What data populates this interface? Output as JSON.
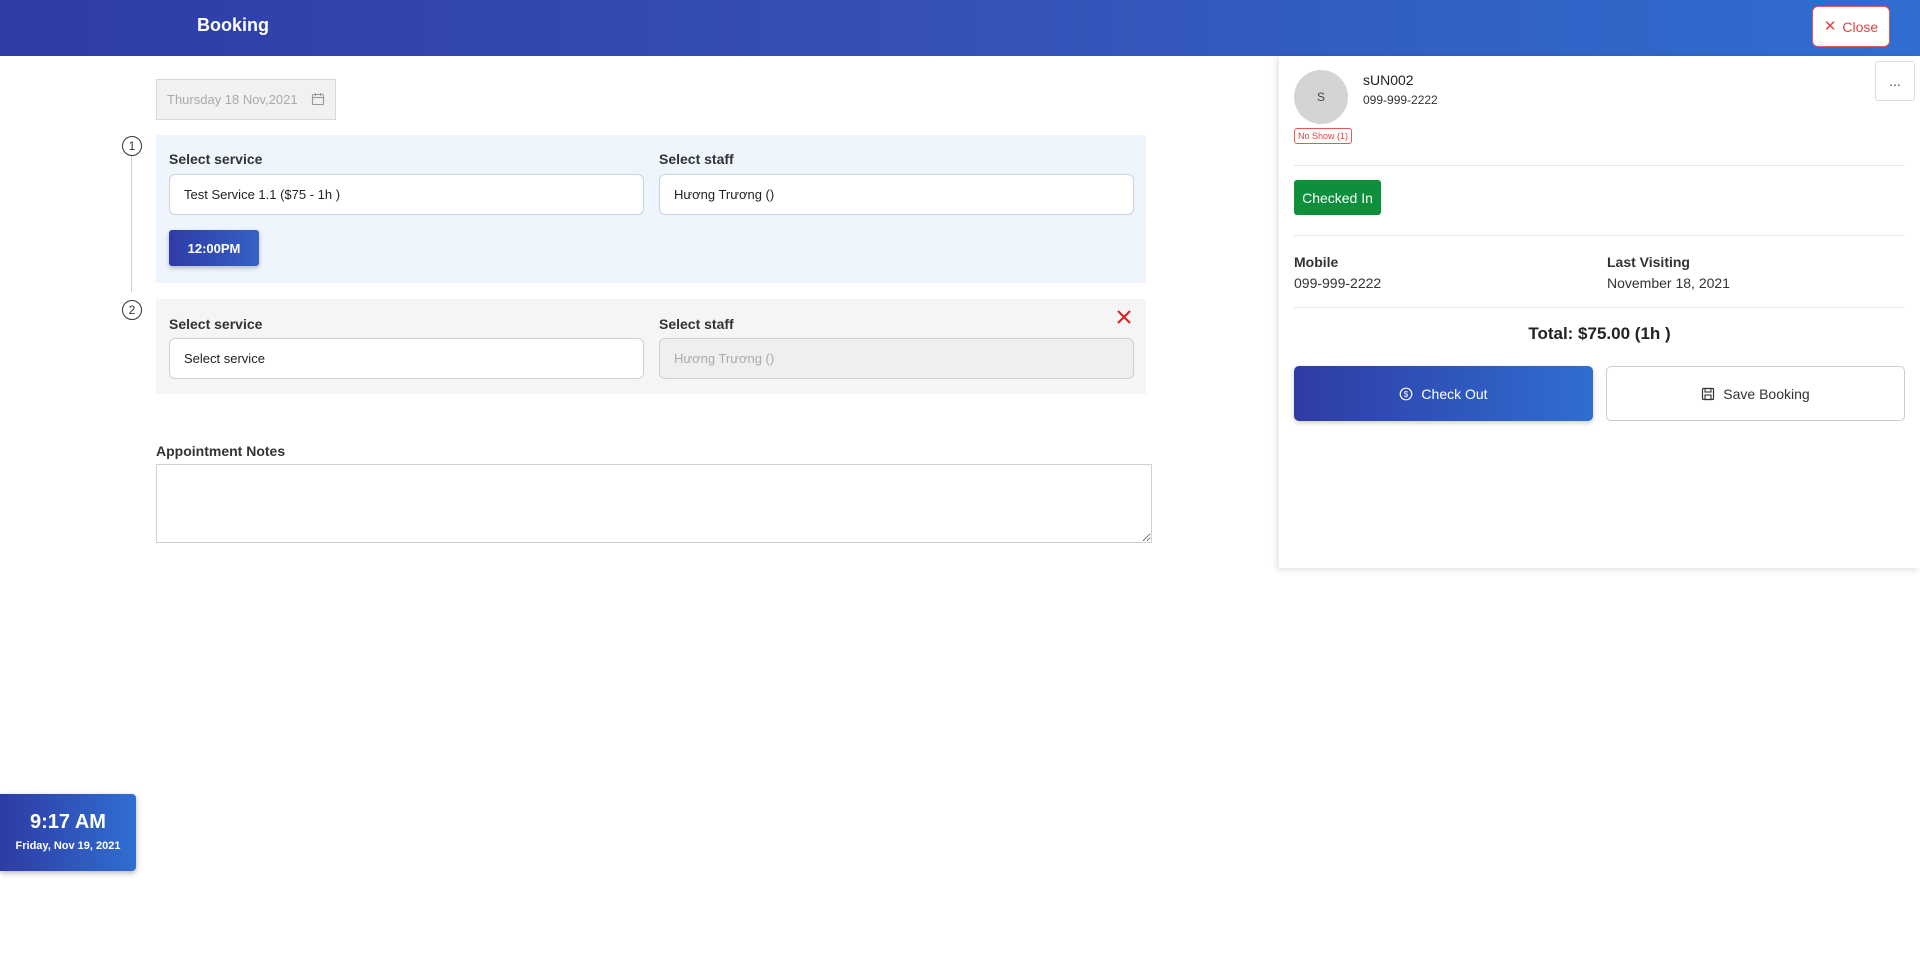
{
  "header": {
    "title": "Booking",
    "close_label": "Close"
  },
  "booking_date": {
    "value": "Thursday 18 Nov,2021"
  },
  "services": [
    {
      "step": "1",
      "service_label": "Select service",
      "service_value": "Test Service 1.1 ($75 - 1h )",
      "staff_label": "Select staff",
      "staff_value": "Hương Trương ()",
      "time": "12:00PM"
    },
    {
      "step": "2",
      "service_label": "Select service",
      "service_value": "Select service",
      "staff_label": "Select staff",
      "staff_value": "Hương Trương ()"
    }
  ],
  "notes": {
    "label": "Appointment Notes",
    "value": ""
  },
  "customer": {
    "avatar_initial": "S",
    "name": "sUN002",
    "phone": "099-999-2222",
    "no_show_badge": "No Show (1)",
    "more_label": "...",
    "status": "Checked In",
    "mobile_label": "Mobile",
    "mobile_value": "099-999-2222",
    "last_visit_label": "Last Visiting",
    "last_visit_value": "November 18, 2021"
  },
  "summary": {
    "total": "Total: $75.00 (1h )",
    "checkout_label": "Check Out",
    "save_label": "Save Booking"
  },
  "clock": {
    "time": "9:17 AM",
    "date": "Friday, Nov 19, 2021"
  },
  "icons": {
    "close": "close-icon",
    "calendar": "calendar-icon",
    "remove": "remove-service-icon",
    "checkout": "dollar-icon",
    "save": "save-icon"
  },
  "colors": {
    "header_gradient_start": "#2f3ba6",
    "header_gradient_end": "#2f6ed0",
    "checked_in": "#0d8f3c",
    "danger": "#e04444"
  }
}
